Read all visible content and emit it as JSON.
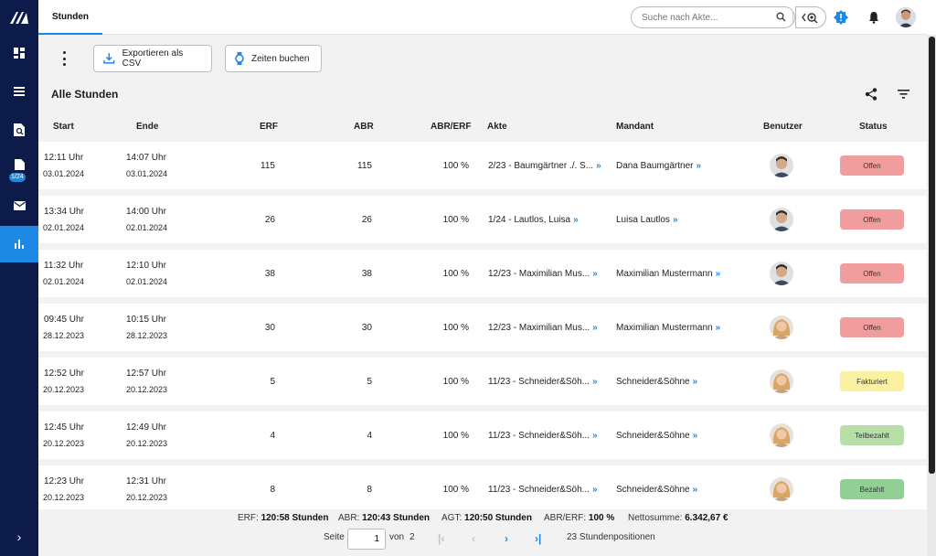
{
  "app": {
    "tab": "Stunden"
  },
  "search": {
    "placeholder": "Suche nach Akte..."
  },
  "toolbar": {
    "export_label": "Exportieren als CSV",
    "book_label": "Zeiten buchen"
  },
  "section": {
    "title": "Alle Stunden"
  },
  "nav": {
    "badge": "1/24"
  },
  "columns": {
    "start": "Start",
    "end": "Ende",
    "erf": "ERF",
    "abr": "ABR",
    "abr_erf": "ABR/ERF",
    "akte": "Akte",
    "mandant": "Mandant",
    "benutzer": "Benutzer",
    "status": "Status"
  },
  "rows": [
    {
      "start_time": "12:11 Uhr",
      "start_date": "03.01.2024",
      "end_time": "14:07 Uhr",
      "end_date": "03.01.2024",
      "erf": "115",
      "abr": "115",
      "ratio": "100 %",
      "akte": "2/23 - Baumgärtner ./. S...",
      "mandant": "Dana Baumgärtner",
      "user": "male",
      "status": "Offen"
    },
    {
      "start_time": "13:34 Uhr",
      "start_date": "02.01.2024",
      "end_time": "14:00 Uhr",
      "end_date": "02.01.2024",
      "erf": "26",
      "abr": "26",
      "ratio": "100 %",
      "akte": "1/24 - Lautlos, Luisa",
      "mandant": "Luisa Lautlos",
      "user": "male",
      "status": "Offen"
    },
    {
      "start_time": "11:32 Uhr",
      "start_date": "02.01.2024",
      "end_time": "12:10 Uhr",
      "end_date": "02.01.2024",
      "erf": "38",
      "abr": "38",
      "ratio": "100 %",
      "akte": "12/23 - Maximilian Mus...",
      "mandant": "Maximilian Mustermann",
      "user": "male",
      "status": "Offen"
    },
    {
      "start_time": "09:45 Uhr",
      "start_date": "28.12.2023",
      "end_time": "10:15 Uhr",
      "end_date": "28.12.2023",
      "erf": "30",
      "abr": "30",
      "ratio": "100 %",
      "akte": "12/23 - Maximilian Mus...",
      "mandant": "Maximilian Mustermann",
      "user": "female",
      "status": "Offen"
    },
    {
      "start_time": "12:52 Uhr",
      "start_date": "20.12.2023",
      "end_time": "12:57 Uhr",
      "end_date": "20.12.2023",
      "erf": "5",
      "abr": "5",
      "ratio": "100 %",
      "akte": "11/23 - Schneider&Söh...",
      "mandant": "Schneider&Söhne",
      "user": "female",
      "status": "Fakturiert"
    },
    {
      "start_time": "12:45 Uhr",
      "start_date": "20.12.2023",
      "end_time": "12:49 Uhr",
      "end_date": "20.12.2023",
      "erf": "4",
      "abr": "4",
      "ratio": "100 %",
      "akte": "11/23 - Schneider&Söh...",
      "mandant": "Schneider&Söhne",
      "user": "female",
      "status": "Teilbezahlt"
    },
    {
      "start_time": "12:23 Uhr",
      "start_date": "20.12.2023",
      "end_time": "12:31 Uhr",
      "end_date": "20.12.2023",
      "erf": "8",
      "abr": "8",
      "ratio": "100 %",
      "akte": "11/23 - Schneider&Söh...",
      "mandant": "Schneider&Söhne",
      "user": "female",
      "status": "Bezahlt"
    }
  ],
  "status_colors": {
    "Offen": "#f19d9d",
    "Fakturiert": "#fbf1a3",
    "Teilbezahlt": "#b7dfa8",
    "Bezahlt": "#92cf95"
  },
  "summary": {
    "erf_label": "ERF:",
    "erf_value": "120:58 Stunden",
    "abr_label": "ABR:",
    "abr_value": "120:43 Stunden",
    "agt_label": "AGT:",
    "agt_value": "120:50 Stunden",
    "ratio_label": "ABR/ERF:",
    "ratio_value": "100 %",
    "net_label": "Nettosumme:",
    "net_value": "6.342,67 €"
  },
  "pagination": {
    "page_label": "Seite",
    "page": "1",
    "of_label": "von",
    "total_pages": "2",
    "count": "23 Stundenpositionen"
  },
  "accent": "#1e88e5"
}
